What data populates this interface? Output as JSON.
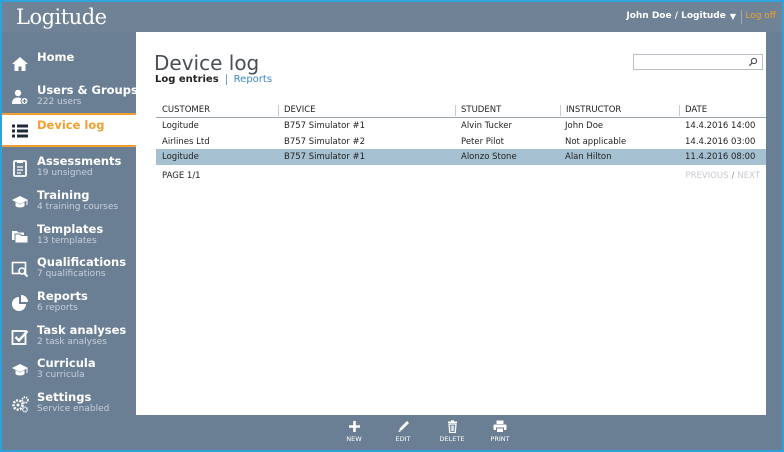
{
  "app": {
    "logo": "Logitude",
    "user": "John Doe / Logitude",
    "logoff": "Log off"
  },
  "sidebar": {
    "items": [
      {
        "label": "Home",
        "sub": ""
      },
      {
        "label": "Users & Groups",
        "sub": "222 users"
      },
      {
        "label": "Device log",
        "sub": ""
      },
      {
        "label": "Assessments",
        "sub": "19 unsigned"
      },
      {
        "label": "Training",
        "sub": "4 training courses"
      },
      {
        "label": "Templates",
        "sub": "13 templates"
      },
      {
        "label": "Qualifications",
        "sub": "7 qualifications"
      },
      {
        "label": "Reports",
        "sub": "6 reports"
      },
      {
        "label": "Task analyses",
        "sub": "2 task analyses"
      },
      {
        "label": "Curricula",
        "sub": "3 curricula"
      },
      {
        "label": "Settings",
        "sub": "Service enabled"
      }
    ]
  },
  "main": {
    "title": "Device log",
    "tabs": [
      {
        "label": "Log entries",
        "active": true
      },
      {
        "label": "Reports",
        "active": false
      }
    ],
    "search": {
      "value": "",
      "placeholder": ""
    },
    "table": {
      "headers": [
        "CUSTOMER",
        "DEVICE",
        "STUDENT",
        "INSTRUCTOR",
        "DATE"
      ],
      "rows": [
        [
          "Logitude",
          "B757 Simulator #1",
          "Alvin Tucker",
          "John Doe",
          "14.4.2016 14:00"
        ],
        [
          "Airlines Ltd",
          "B757 Simulator #2",
          "Peter Pilot",
          "Not applicable",
          "14.4.2016 03:00"
        ],
        [
          "Logitude",
          "B757 Simulator #1",
          "Alonzo Stone",
          "Alan Hilton",
          "11.4.2016 08:00"
        ]
      ],
      "selected_row": 3
    },
    "pager": {
      "page_label": "PAGE 1/1",
      "previous": "PREVIOUS",
      "separator": "/",
      "next": "NEXT"
    }
  },
  "toolbar": {
    "new_label": "NEW",
    "edit_label": "EDIT",
    "delete_label": "DELETE",
    "print_label": "PRINT"
  },
  "colors": {
    "accent": "#f0a030",
    "sidebar": "#6b7f94",
    "selected_row": "#a5c1d1",
    "link": "#3f87c2",
    "frame": "#2fa3d9"
  }
}
